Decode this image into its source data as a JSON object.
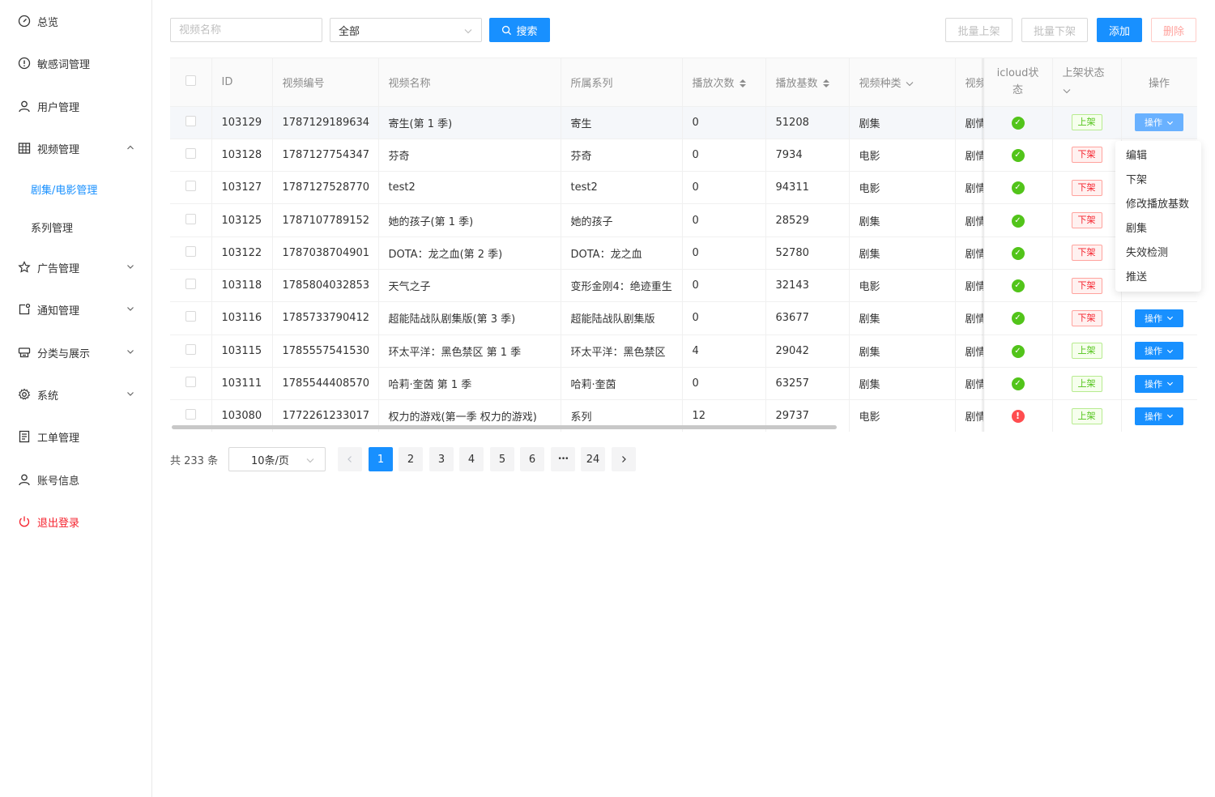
{
  "sidebar": {
    "items": [
      {
        "label": "总览",
        "icon": "dashboard-icon"
      },
      {
        "label": "敏感词管理",
        "icon": "alert-circle-icon"
      },
      {
        "label": "用户管理",
        "icon": "user-icon"
      },
      {
        "label": "视频管理",
        "icon": "table-icon",
        "expanded": true
      },
      {
        "label": "广告管理",
        "icon": "star-icon"
      },
      {
        "label": "通知管理",
        "icon": "notification-icon"
      },
      {
        "label": "分类与展示",
        "icon": "category-icon"
      },
      {
        "label": "系统",
        "icon": "gear-icon"
      },
      {
        "label": "工单管理",
        "icon": "document-icon"
      },
      {
        "label": "账号信息",
        "icon": "user-icon"
      },
      {
        "label": "退出登录",
        "icon": "power-icon"
      }
    ],
    "sub_items": [
      {
        "label": "剧集/电影管理",
        "active": true
      },
      {
        "label": "系列管理",
        "active": false
      }
    ]
  },
  "toolbar": {
    "search_placeholder": "视频名称",
    "select_value": "全部",
    "search_label": "搜索",
    "batch_on_label": "批量上架",
    "batch_off_label": "批量下架",
    "add_label": "添加",
    "delete_label": "删除"
  },
  "table": {
    "headers": {
      "id": "ID",
      "code": "视频编号",
      "name": "视频名称",
      "series": "所属系列",
      "plays": "播放次数",
      "base": "播放基数",
      "kind": "视频种类",
      "genre": "视频",
      "icloud": "icloud状态",
      "shelf": "上架状态",
      "ops": "操作"
    },
    "rows": [
      {
        "id": "103129",
        "code": "1787129189634",
        "name": "寄生(第 1 季)",
        "series": "寄生",
        "plays": "0",
        "base": "51208",
        "kind": "剧集",
        "genre": "剧情",
        "icloud": "ok",
        "shelf": "上架",
        "shelf_on": true,
        "op": "操作"
      },
      {
        "id": "103128",
        "code": "1787127754347",
        "name": "芬奇",
        "series": "芬奇",
        "plays": "0",
        "base": "7934",
        "kind": "电影",
        "genre": "剧情",
        "icloud": "ok",
        "shelf": "下架",
        "shelf_on": false,
        "op": ""
      },
      {
        "id": "103127",
        "code": "1787127528770",
        "name": "test2",
        "series": "test2",
        "plays": "0",
        "base": "94311",
        "kind": "电影",
        "genre": "剧情",
        "icloud": "ok",
        "shelf": "下架",
        "shelf_on": false,
        "op": ""
      },
      {
        "id": "103125",
        "code": "1787107789152",
        "name": "她的孩子(第 1 季)",
        "series": "她的孩子",
        "plays": "0",
        "base": "28529",
        "kind": "剧集",
        "genre": "剧情",
        "icloud": "ok",
        "shelf": "下架",
        "shelf_on": false,
        "op": ""
      },
      {
        "id": "103122",
        "code": "1787038704901",
        "name": "DOTA：龙之血(第 2 季)",
        "series": "DOTA：龙之血",
        "plays": "0",
        "base": "52780",
        "kind": "剧集",
        "genre": "剧情",
        "icloud": "ok",
        "shelf": "下架",
        "shelf_on": false,
        "op": ""
      },
      {
        "id": "103118",
        "code": "1785804032853",
        "name": "天气之子",
        "series": "变形金刚4：绝迹重生",
        "plays": "0",
        "base": "32143",
        "kind": "电影",
        "genre": "剧情",
        "icloud": "ok",
        "shelf": "下架",
        "shelf_on": false,
        "op": ""
      },
      {
        "id": "103116",
        "code": "1785733790412",
        "name": "超能陆战队剧集版(第 3 季)",
        "series": "超能陆战队剧集版",
        "plays": "0",
        "base": "63677",
        "kind": "剧集",
        "genre": "剧情",
        "icloud": "ok",
        "shelf": "下架",
        "shelf_on": false,
        "op": "操作"
      },
      {
        "id": "103115",
        "code": "1785557541530",
        "name": "环太平洋：黑色禁区 第 1 季",
        "series": "环太平洋：黑色禁区",
        "plays": "4",
        "base": "29042",
        "kind": "剧集",
        "genre": "剧情",
        "icloud": "ok",
        "shelf": "上架",
        "shelf_on": true,
        "op": "操作"
      },
      {
        "id": "103111",
        "code": "1785544408570",
        "name": "哈莉·奎茵 第 1 季",
        "series": "哈莉·奎茵",
        "plays": "0",
        "base": "63257",
        "kind": "剧集",
        "genre": "剧情",
        "icloud": "ok",
        "shelf": "上架",
        "shelf_on": true,
        "op": "操作"
      },
      {
        "id": "103080",
        "code": "1772261233017",
        "name": "权力的游戏(第一季 权力的游戏)",
        "series": "系列",
        "plays": "12",
        "base": "29737",
        "kind": "电影",
        "genre": "剧情",
        "icloud": "error",
        "shelf": "上架",
        "shelf_on": true,
        "op": "操作"
      }
    ]
  },
  "dropdown": {
    "items": [
      "编辑",
      "下架",
      "修改播放基数",
      "剧集",
      "失效检测",
      "推送"
    ]
  },
  "pagination": {
    "total": "共 233 条",
    "page_size": "10条/页",
    "pages": [
      "1",
      "2",
      "3",
      "4",
      "5",
      "6",
      "•••",
      "24"
    ],
    "current": "1"
  },
  "colors": {
    "primary": "#1890ff",
    "success": "#52c41a",
    "danger": "#f5222d"
  }
}
